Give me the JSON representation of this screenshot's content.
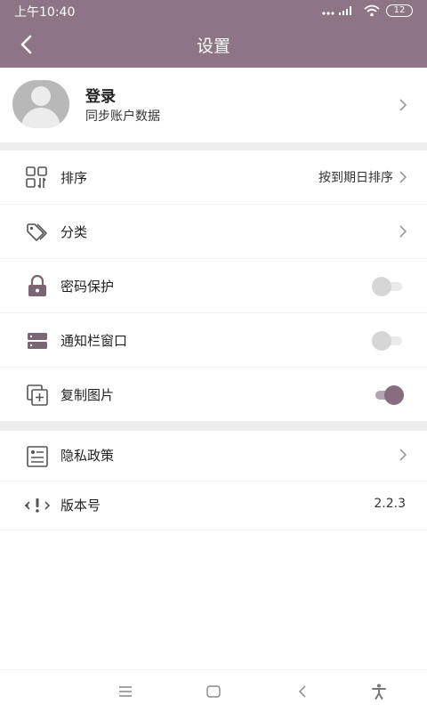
{
  "status_bar": {
    "time": "上午10:40",
    "battery": "12"
  },
  "header": {
    "title": "设置"
  },
  "profile": {
    "name": "登录",
    "subtitle": "同步账户数据"
  },
  "settings": {
    "sort": {
      "label": "排序",
      "value": "按到期日排序"
    },
    "category": {
      "label": "分类"
    },
    "password": {
      "label": "密码保护",
      "enabled": false
    },
    "notification": {
      "label": "通知栏窗口",
      "enabled": false
    },
    "copy_image": {
      "label": "复制图片",
      "enabled": true
    },
    "privacy": {
      "label": "隐私政策"
    },
    "version": {
      "label": "版本号",
      "value": "2.2.3"
    }
  },
  "colors": {
    "accent": "#8d7585",
    "toggle_on": "#876d7e"
  }
}
